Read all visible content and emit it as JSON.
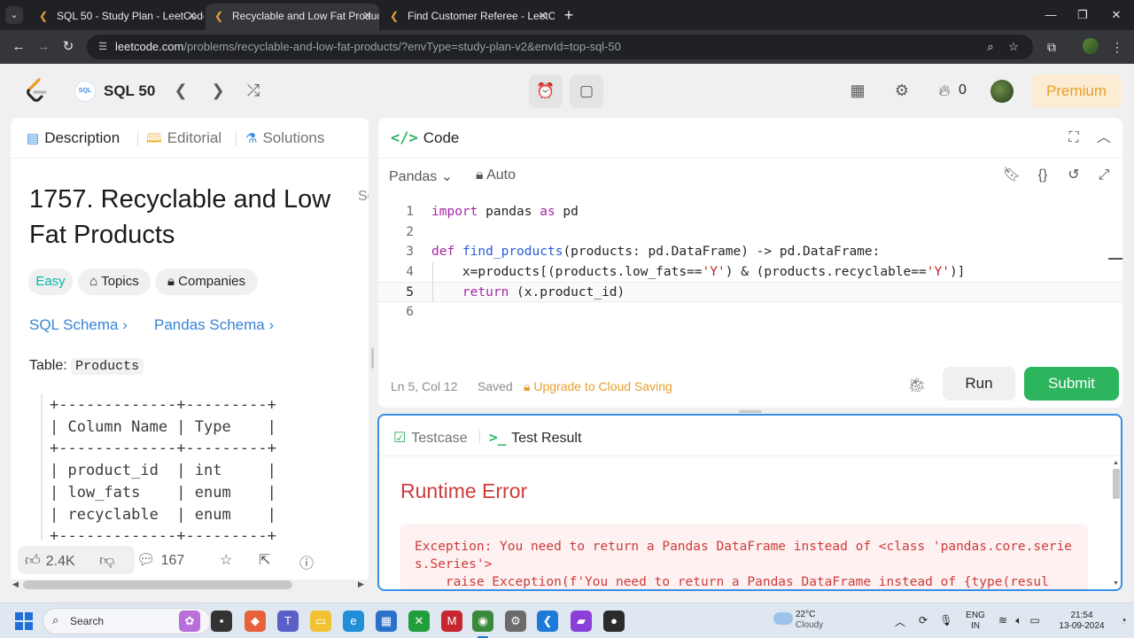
{
  "browser": {
    "tabs": [
      {
        "title": "SQL 50 - Study Plan - LeetCode",
        "active": false
      },
      {
        "title": "Recyclable and Low Fat Product",
        "active": true
      },
      {
        "title": "Find Customer Referee - LeetCo",
        "active": false
      }
    ],
    "url_host": "leetcode.com",
    "url_path": "/problems/recyclable-and-low-fat-products/?envType=study-plan-v2&envId=top-sql-50"
  },
  "header": {
    "sql_badge": "SQL",
    "plan_title": "SQL 50",
    "streak_count": "0",
    "premium_label": "Premium"
  },
  "left": {
    "tabs": {
      "description": "Description",
      "editorial": "Editorial",
      "solutions": "Solutions"
    },
    "cut_text": "Sc",
    "title": "1757. Recyclable and Low Fat Products",
    "chips": {
      "difficulty": "Easy",
      "topics": "Topics",
      "companies": "Companies"
    },
    "links": {
      "sql_schema": "SQL Schema",
      "pandas_schema": "Pandas Schema"
    },
    "table_label": "Table:",
    "table_name": "Products",
    "schema_lines": [
      "+-------------+---------+",
      "| Column Name | Type    |",
      "+-------------+---------+",
      "| product_id  | int     |",
      "| low_fats    | enum    |",
      "| recyclable  | enum    |",
      "+-------------+---------+"
    ],
    "likes": "2.4K",
    "comments": "167"
  },
  "code": {
    "title": "Code",
    "language": "Pandas",
    "auto_label": "Auto",
    "lines": [
      {
        "n": "1",
        "html": "<span class='kw'>import</span> pandas <span class='kw'>as</span> pd"
      },
      {
        "n": "2",
        "html": ""
      },
      {
        "n": "3",
        "html": "<span class='kw'>def</span> <span class='fn'>find_products</span>(products: pd.DataFrame) -> pd.DataFrame:"
      },
      {
        "n": "4",
        "html": "    x=products[(products.low_fats==<span class='str'>'Y'</span>) &amp; (products.recyclable==<span class='str'>'Y'</span>)]"
      },
      {
        "n": "5",
        "html": "    <span class='kw'>return</span> (x.product_id)"
      },
      {
        "n": "6",
        "html": ""
      }
    ],
    "cursor_line": 5,
    "position": "Ln 5, Col 12",
    "saved": "Saved",
    "upgrade": "Upgrade to Cloud Saving",
    "run_label": "Run",
    "submit_label": "Submit"
  },
  "test": {
    "testcase_tab": "Testcase",
    "result_tab": "Test Result",
    "error_title": "Runtime Error",
    "error_lines": [
      "Exception: You need to return a Pandas DataFrame instead of <class 'pandas.core.series.Series'>",
      "    raise Exception(f'You need to return a Pandas DataFrame instead of {type(resul"
    ]
  },
  "taskbar": {
    "search": "Search",
    "temperature": "22°C",
    "weather": "Cloudy",
    "lang_line1": "ENG",
    "lang_line2": "IN",
    "time": "21:54",
    "date": "13-09-2024"
  },
  "colors": {
    "accent_green": "#2db55d",
    "error_red": "#ce3b3b",
    "premium_orange": "#e79f2a",
    "link_blue": "#3784d6"
  }
}
